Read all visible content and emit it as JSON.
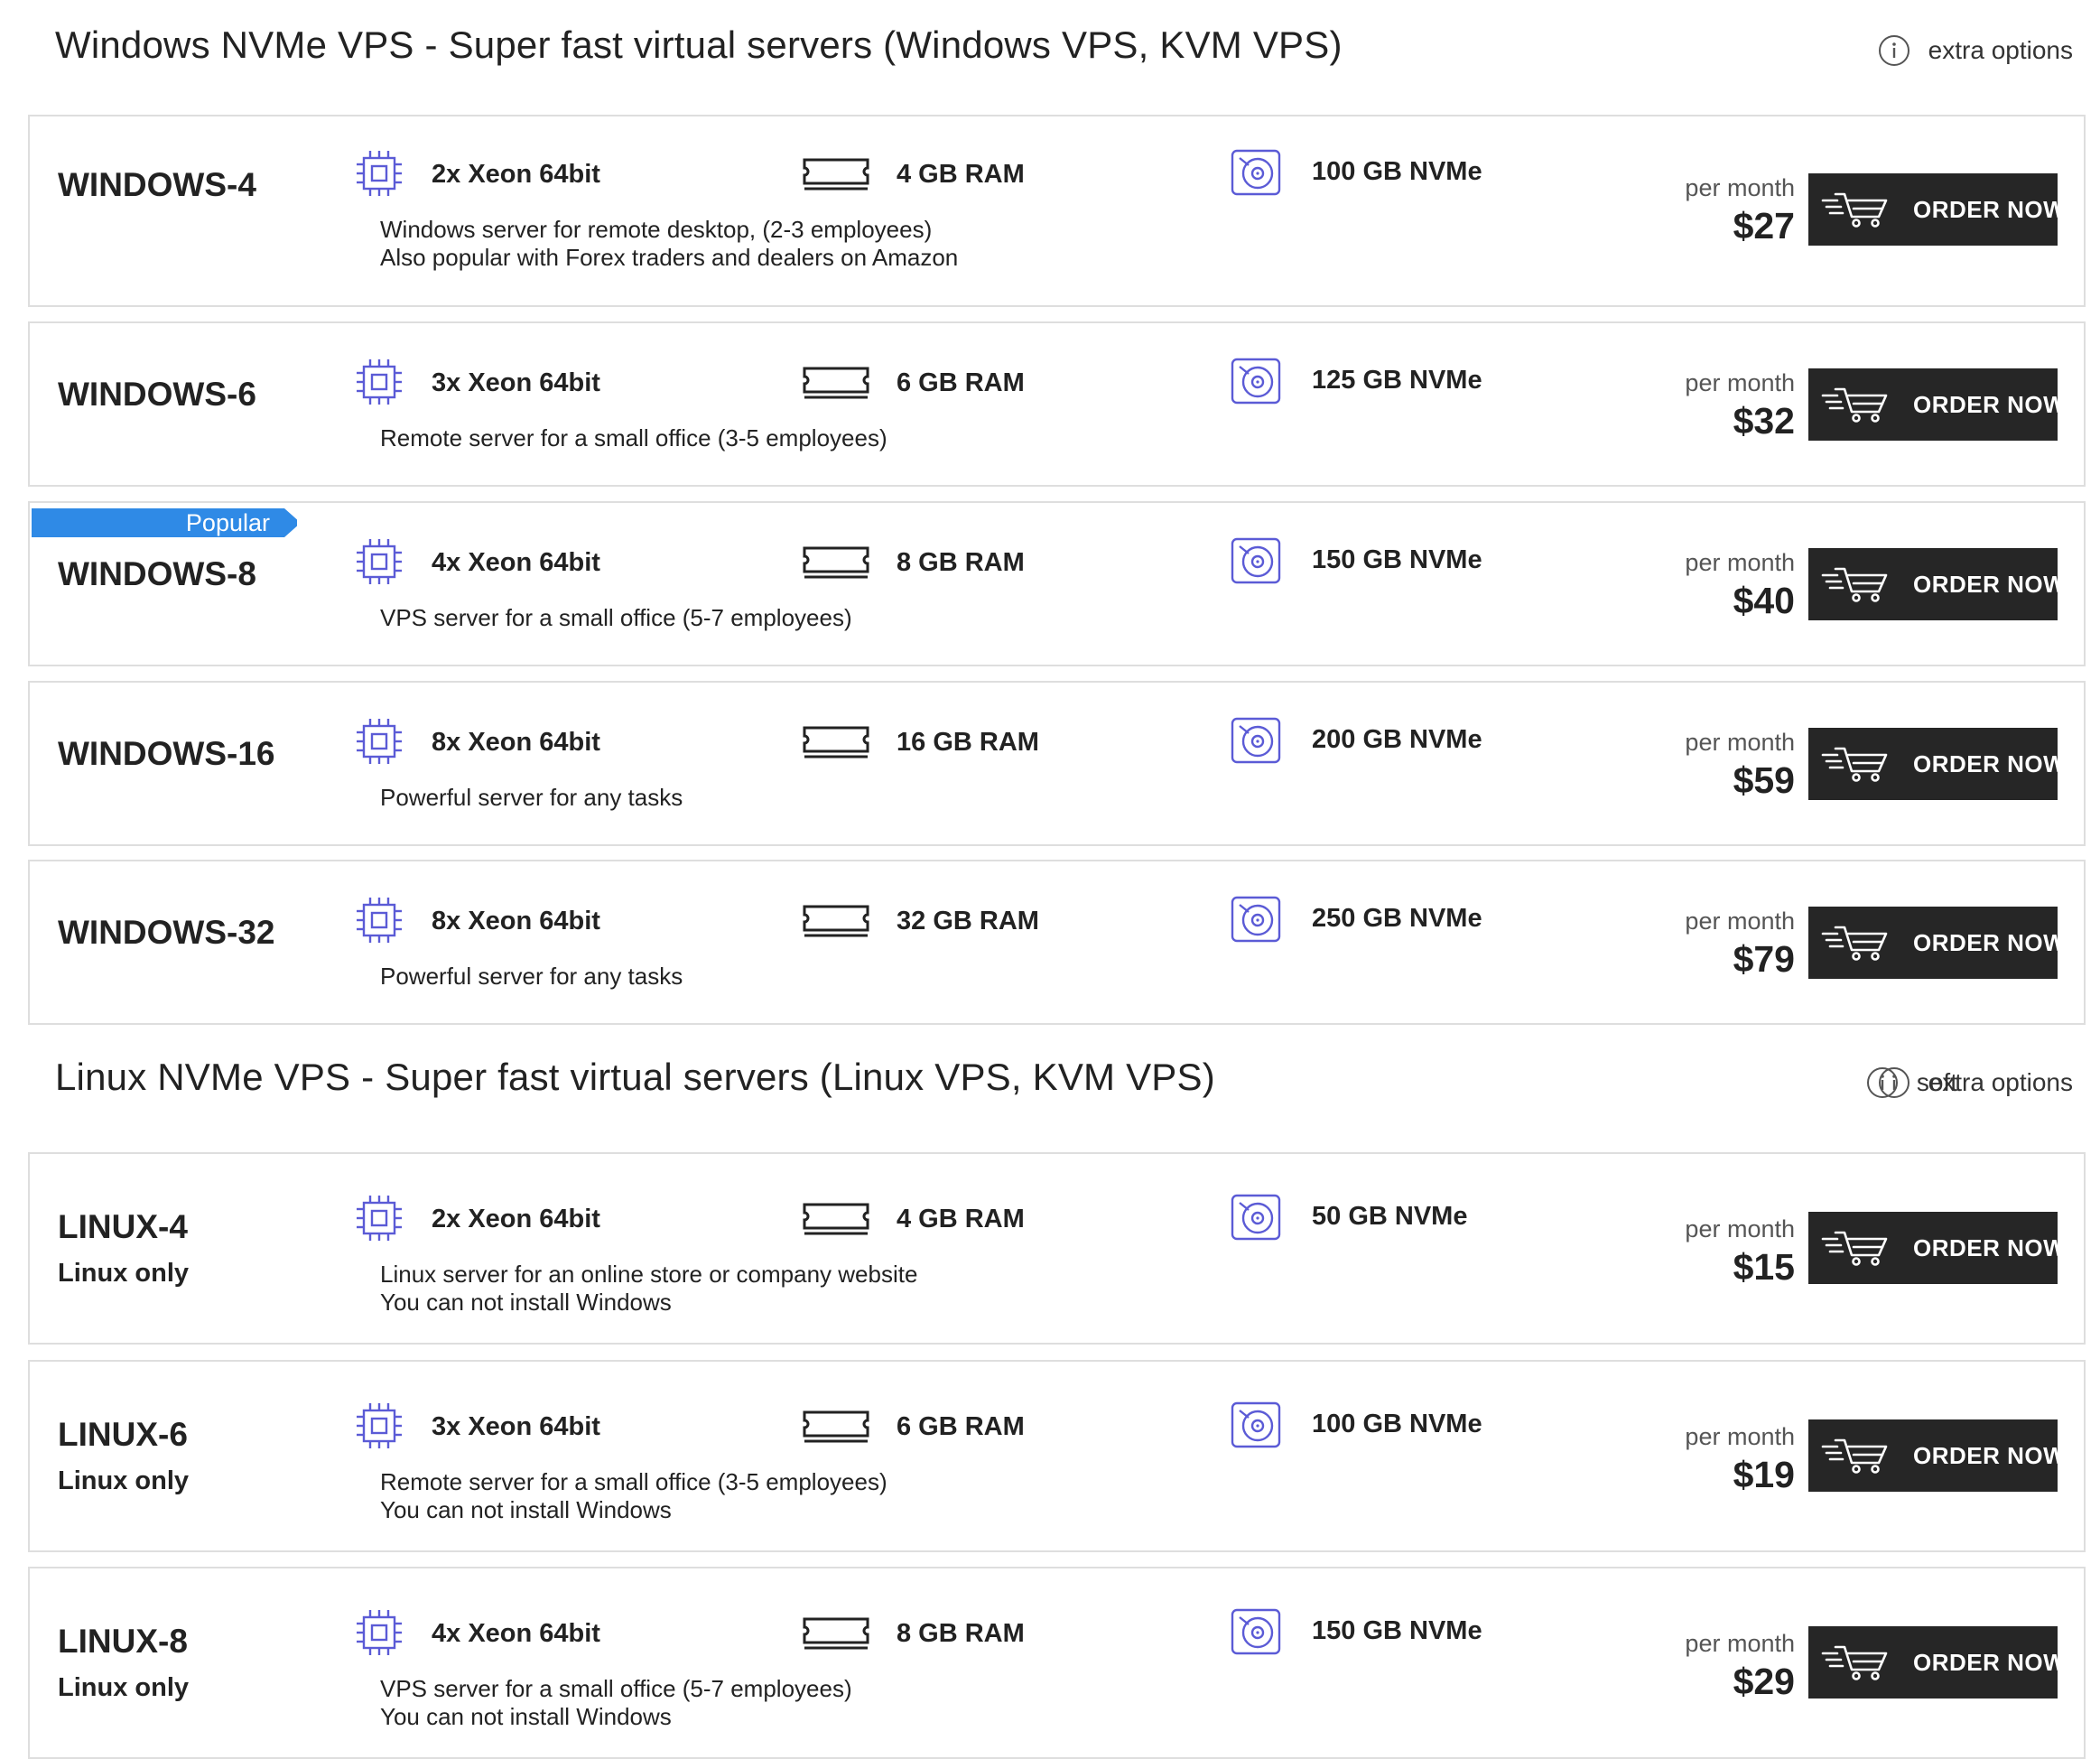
{
  "windows_section": {
    "title": "Windows NVMe VPS - Super fast virtual servers (Windows VPS, KVM VPS)",
    "extra_options_label": "extra options",
    "plans": [
      {
        "name": "WINDOWS-4",
        "cpu": "2x Xeon 64bit",
        "ram": "4 GB RAM",
        "disk": "100 GB NVMe",
        "desc1": "Windows server for remote desktop, (2-3 employees)",
        "desc2": "Also popular with Forex traders and dealers on Amazon",
        "per_month": "per month",
        "price": "$27",
        "order": "ORDER NOW"
      },
      {
        "name": "WINDOWS-6",
        "cpu": "3x Xeon 64bit",
        "ram": "6 GB RAM",
        "disk": "125 GB NVMe",
        "desc1": "Remote server for a small office (3-5 employees)",
        "per_month": "per month",
        "price": "$32",
        "order": "ORDER NOW"
      },
      {
        "name": "WINDOWS-8",
        "badge": "Popular",
        "cpu": "4x Xeon 64bit",
        "ram": "8 GB RAM",
        "disk": "150 GB NVMe",
        "desc1": "VPS server for a small office (5-7 employees)",
        "per_month": "per month",
        "price": "$40",
        "order": "ORDER NOW"
      },
      {
        "name": "WINDOWS-16",
        "cpu": "8x Xeon 64bit",
        "ram": "16 GB RAM",
        "disk": "200 GB NVMe",
        "desc1": "Powerful server for any tasks",
        "per_month": "per month",
        "price": "$59",
        "order": "ORDER NOW"
      },
      {
        "name": "WINDOWS-32",
        "cpu": "8x Xeon 64bit",
        "ram": "32 GB RAM",
        "disk": "250 GB NVMe",
        "desc1": "Powerful server for any tasks",
        "per_month": "per month",
        "price": "$79",
        "order": "ORDER NOW"
      }
    ]
  },
  "linux_section": {
    "title": "Linux NVMe VPS - Super fast virtual servers (Linux VPS, KVM VPS)",
    "soft_label": "soft",
    "extra_options_label": "extra options",
    "plans": [
      {
        "name": "LINUX-4",
        "sub": "Linux only",
        "cpu": "2x Xeon 64bit",
        "ram": "4 GB RAM",
        "disk": "50 GB NVMe",
        "desc1": "Linux server for an online store or company website",
        "desc2": "You can not install Windows",
        "per_month": "per month",
        "price": "$15",
        "order": "ORDER NOW"
      },
      {
        "name": "LINUX-6",
        "sub": "Linux only",
        "cpu": "3x Xeon 64bit",
        "ram": "6 GB RAM",
        "disk": "100 GB NVMe",
        "desc1": "Remote server for a small office (3-5 employees)",
        "desc2": "You can not install Windows",
        "per_month": "per month",
        "price": "$19",
        "order": "ORDER NOW"
      },
      {
        "name": "LINUX-8",
        "sub": "Linux only",
        "cpu": "4x Xeon 64bit",
        "ram": "8 GB RAM",
        "disk": "150 GB NVMe",
        "desc1": "VPS server for a small office (5-7 employees)",
        "desc2": "You can not install Windows",
        "per_month": "per month",
        "price": "$29",
        "order": "ORDER NOW"
      }
    ]
  },
  "icons": {
    "info": "info-icon",
    "cpu": "cpu-chip-icon",
    "ram": "ram-stick-icon",
    "disk": "disk-drive-icon",
    "cart": "shopping-cart-icon"
  },
  "colors": {
    "icon_purple": "#5b5bd6",
    "button_bg": "#262626",
    "badge_blue": "#2f8ae6",
    "border": "#dedede"
  }
}
